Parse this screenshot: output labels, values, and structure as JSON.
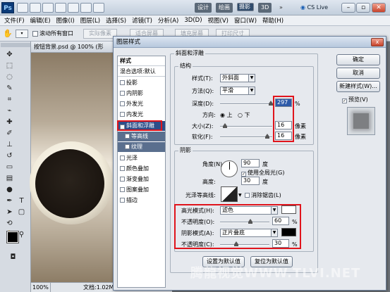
{
  "app": {
    "logo": "Ps",
    "workspaces": [
      "设计",
      "绘画",
      "摄影",
      "3D"
    ],
    "workspace_selected": "摄影",
    "more": "»",
    "cs_live": "CS Live"
  },
  "menu": [
    "文件(F)",
    "编辑(E)",
    "图像(I)",
    "图层(L)",
    "选择(S)",
    "滤镜(T)",
    "分析(A)",
    "3D(D)",
    "视图(V)",
    "窗口(W)",
    "帮助(H)"
  ],
  "options": {
    "scroll_all": "滚动所有窗口",
    "btn_actual": "实际像素",
    "btn_fit": "适合屏幕",
    "btn_fill": "填充屏幕",
    "btn_print": "打印尺寸"
  },
  "document": {
    "tab": "按钮背景.psd @ 100% (形",
    "zoom": "100%",
    "info": "文档:1.02M/7.27M"
  },
  "dialog": {
    "title": "图层样式",
    "close": "x",
    "style_list": [
      {
        "label": "样式",
        "kind": "header"
      },
      {
        "label": "混合选项:默认",
        "kind": "header"
      },
      {
        "label": "投影",
        "checked": false
      },
      {
        "label": "内阴影",
        "checked": false
      },
      {
        "label": "外发光",
        "checked": false
      },
      {
        "label": "内发光",
        "checked": false
      },
      {
        "label": "斜面和浮雕",
        "checked": true,
        "selected": true
      },
      {
        "label": "等高线",
        "checked": false,
        "sub": true
      },
      {
        "label": "纹理",
        "checked": false,
        "sub": true
      },
      {
        "label": "光泽",
        "checked": false
      },
      {
        "label": "颜色叠加",
        "checked": false
      },
      {
        "label": "渐变叠加",
        "checked": false
      },
      {
        "label": "图案叠加",
        "checked": false
      },
      {
        "label": "描边",
        "checked": false
      }
    ],
    "section_title": "斜面和浮雕",
    "structure": {
      "legend": "结构",
      "style_label": "样式(T):",
      "style_value": "外斜面",
      "method_label": "方法(Q):",
      "method_value": "平滑",
      "depth_label": "深度(D):",
      "depth_value": "297",
      "depth_unit": "%",
      "direction_label": "方向:",
      "dir_up": "上",
      "dir_down": "下",
      "size_label": "大小(Z):",
      "size_value": "16",
      "size_unit": "像素",
      "soften_label": "软化(F):",
      "soften_value": "16",
      "soften_unit": "像素"
    },
    "shading": {
      "legend": "阴影",
      "angle_label": "角度(N):",
      "angle_value": "90",
      "angle_unit": "度",
      "global_light": "使用全局光(G)",
      "altitude_label": "高度:",
      "altitude_value": "30",
      "altitude_unit": "度",
      "gloss_label": "光泽等高线:",
      "anti_alias": "消除锯齿(L)",
      "highlight_label": "高光模式(H):",
      "highlight_mode": "滤色",
      "highlight_color": "#ffffff",
      "hl_opacity_label": "不透明度(O):",
      "hl_opacity": "60",
      "hl_opacity_unit": "%",
      "shadow_label": "阴影模式(A):",
      "shadow_mode": "正片叠底",
      "shadow_color": "#000000",
      "sh_opacity_label": "不透明度(C):",
      "sh_opacity": "30",
      "sh_opacity_unit": "%"
    },
    "btn_set_default": "设置为默认值",
    "btn_reset_default": "复位为默认值",
    "ok": "确定",
    "cancel": "取消",
    "new_style": "新建样式(W)...",
    "preview": "预览(V)"
  },
  "watermark": "腾龍视觉WWW.TLVI.NET"
}
